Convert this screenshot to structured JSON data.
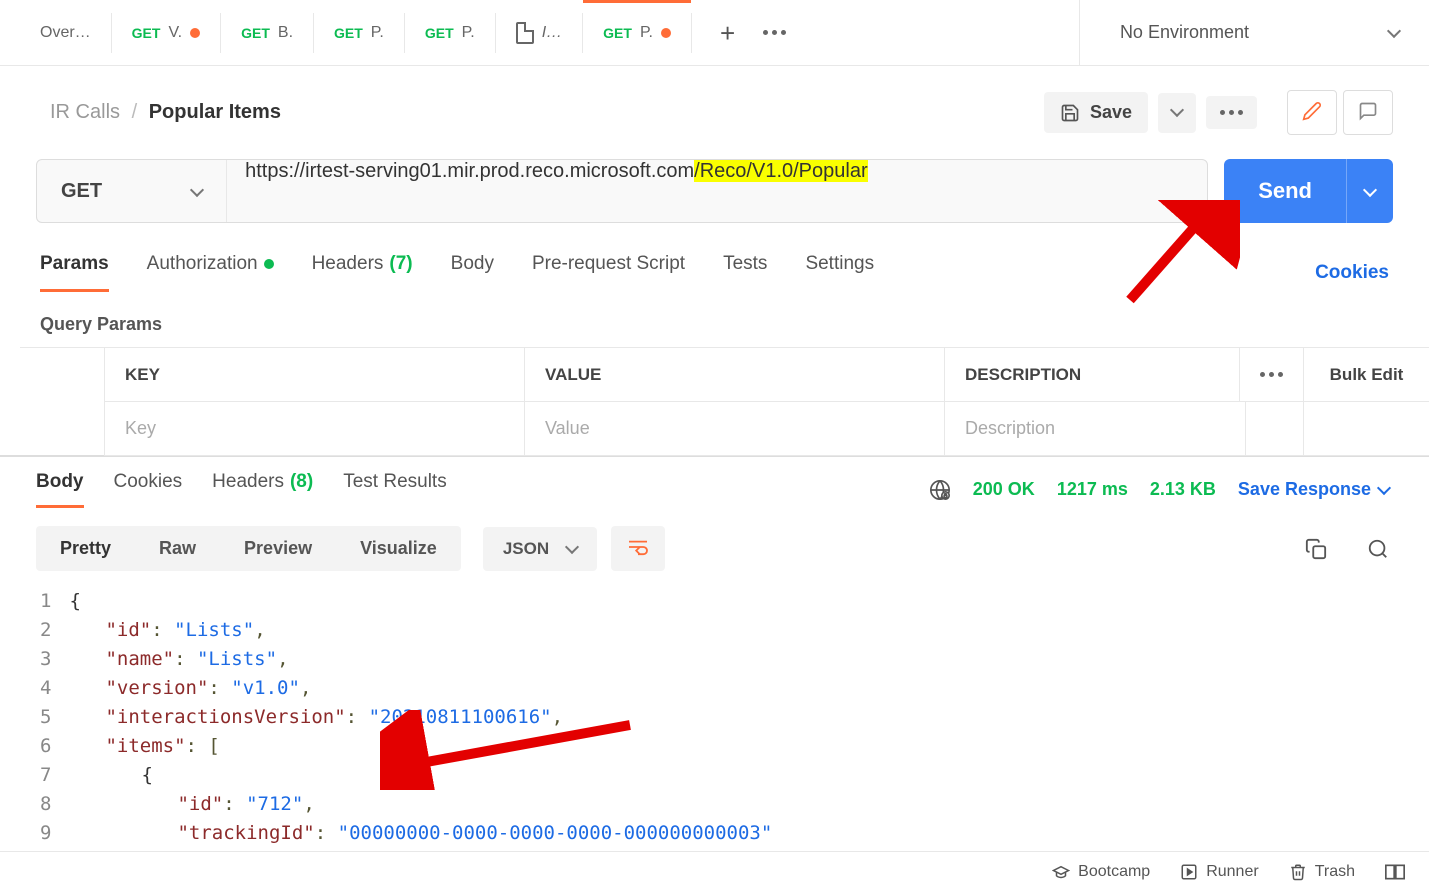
{
  "topTabs": [
    {
      "label": "Over…",
      "method": ""
    },
    {
      "label": "V.",
      "method": "GET",
      "dot": true
    },
    {
      "label": "B.",
      "method": "GET"
    },
    {
      "label": "P.",
      "method": "GET"
    },
    {
      "label": "P.",
      "method": "GET"
    },
    {
      "label": "I…",
      "method": "",
      "pageIcon": true
    },
    {
      "label": "P.",
      "method": "GET",
      "dot": true,
      "active": true
    }
  ],
  "env": {
    "label": "No Environment"
  },
  "breadcrumb": {
    "parent": "IR Calls",
    "sep": "/",
    "current": "Popular Items"
  },
  "saveLabel": "Save",
  "request": {
    "method": "GET",
    "urlPlain": "https://irtest-serving01.mir.prod.reco.microsoft.com",
    "urlHighlighted": "/Reco/V1.0/Popular"
  },
  "sendLabel": "Send",
  "reqTabs": [
    {
      "label": "Params",
      "active": true
    },
    {
      "label": "Authorization",
      "dot": true
    },
    {
      "label": "Headers",
      "count": "(7)"
    },
    {
      "label": "Body"
    },
    {
      "label": "Pre-request Script"
    },
    {
      "label": "Tests"
    },
    {
      "label": "Settings"
    }
  ],
  "cookiesLink": "Cookies",
  "queryParamsLabel": "Query Params",
  "paramsHeader": {
    "key": "KEY",
    "value": "VALUE",
    "desc": "DESCRIPTION",
    "bulk": "Bulk Edit"
  },
  "paramsPlaceholder": {
    "key": "Key",
    "value": "Value",
    "desc": "Description"
  },
  "respTabs": [
    {
      "label": "Body",
      "active": true
    },
    {
      "label": "Cookies"
    },
    {
      "label": "Headers",
      "count": "(8)"
    },
    {
      "label": "Test Results"
    }
  ],
  "respStats": {
    "status": "200 OK",
    "time": "1217 ms",
    "size": "2.13 KB"
  },
  "saveResponse": "Save Response",
  "viewModes": [
    "Pretty",
    "Raw",
    "Preview",
    "Visualize"
  ],
  "formatLabel": "JSON",
  "codeLines": [
    {
      "n": "1",
      "indent": 0,
      "tokens": [
        {
          "t": "{",
          "c": "brace"
        }
      ]
    },
    {
      "n": "2",
      "indent": 1,
      "tokens": [
        {
          "t": "\"id\"",
          "c": "key"
        },
        {
          "t": ": ",
          "c": "p"
        },
        {
          "t": "\"Lists\"",
          "c": "str"
        },
        {
          "t": ",",
          "c": "p"
        }
      ]
    },
    {
      "n": "3",
      "indent": 1,
      "tokens": [
        {
          "t": "\"name\"",
          "c": "key"
        },
        {
          "t": ": ",
          "c": "p"
        },
        {
          "t": "\"Lists\"",
          "c": "str"
        },
        {
          "t": ",",
          "c": "p"
        }
      ]
    },
    {
      "n": "4",
      "indent": 1,
      "tokens": [
        {
          "t": "\"version\"",
          "c": "key"
        },
        {
          "t": ": ",
          "c": "p"
        },
        {
          "t": "\"v1.0\"",
          "c": "str"
        },
        {
          "t": ",",
          "c": "p"
        }
      ]
    },
    {
      "n": "5",
      "indent": 1,
      "tokens": [
        {
          "t": "\"interactionsVersion\"",
          "c": "key"
        },
        {
          "t": ": ",
          "c": "p"
        },
        {
          "t": "\"20210811100616\"",
          "c": "str"
        },
        {
          "t": ",",
          "c": "p"
        }
      ]
    },
    {
      "n": "6",
      "indent": 1,
      "tokens": [
        {
          "t": "\"items\"",
          "c": "key"
        },
        {
          "t": ": [",
          "c": "p"
        }
      ]
    },
    {
      "n": "7",
      "indent": 2,
      "tokens": [
        {
          "t": "{",
          "c": "brace"
        }
      ]
    },
    {
      "n": "8",
      "indent": 3,
      "tokens": [
        {
          "t": "\"id\"",
          "c": "key"
        },
        {
          "t": ": ",
          "c": "p"
        },
        {
          "t": "\"712\"",
          "c": "str"
        },
        {
          "t": ",",
          "c": "p"
        }
      ]
    },
    {
      "n": "9",
      "indent": 3,
      "tokens": [
        {
          "t": "\"trackingId\"",
          "c": "key"
        },
        {
          "t": ": ",
          "c": "p"
        },
        {
          "t": "\"00000000-0000-0000-0000-000000000003\"",
          "c": "str"
        }
      ]
    }
  ],
  "statusbar": {
    "bootcamp": "Bootcamp",
    "runner": "Runner",
    "trash": "Trash"
  }
}
